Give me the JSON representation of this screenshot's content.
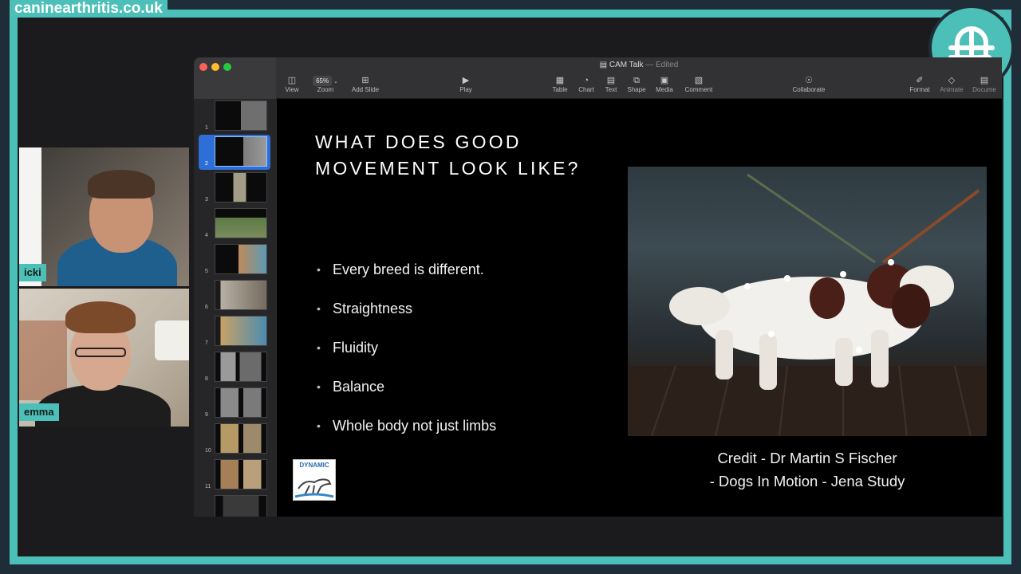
{
  "overlay": {
    "site_label": "caninearthritis.co.uk",
    "brand_color": "#4cc0b8",
    "logo_icon": "ca-monogram-logo"
  },
  "participants": [
    {
      "name": "icki"
    },
    {
      "name": "emma"
    }
  ],
  "keynote": {
    "window_title": "CAM Talk",
    "window_status": "— Edited",
    "toolbar": {
      "view": "View",
      "zoom_value": "65%",
      "zoom": "Zoom",
      "add_slide": "Add Slide",
      "play": "Play",
      "table": "Table",
      "chart": "Chart",
      "text": "Text",
      "shape": "Shape",
      "media": "Media",
      "comment": "Comment",
      "collaborate": "Collaborate",
      "format": "Format",
      "animate": "Animate",
      "document": "Docume"
    },
    "navigator": {
      "slide_numbers": [
        "1",
        "2",
        "3",
        "4",
        "5",
        "6",
        "7",
        "8",
        "9",
        "10",
        "11"
      ],
      "selected_index": 2
    },
    "slide": {
      "title_line1": "WHAT DOES GOOD",
      "title_line2": "MOVEMENT LOOK LIKE?",
      "bullets": [
        "Every breed is different.",
        "Straightness",
        "Fluidity",
        "Balance",
        "Whole body not just limbs"
      ],
      "logo_text": "DYNAMIC",
      "credit_line1": "Credit - Dr Martin S Fischer",
      "credit_line2": "- Dogs In Motion - Jena Study"
    }
  }
}
